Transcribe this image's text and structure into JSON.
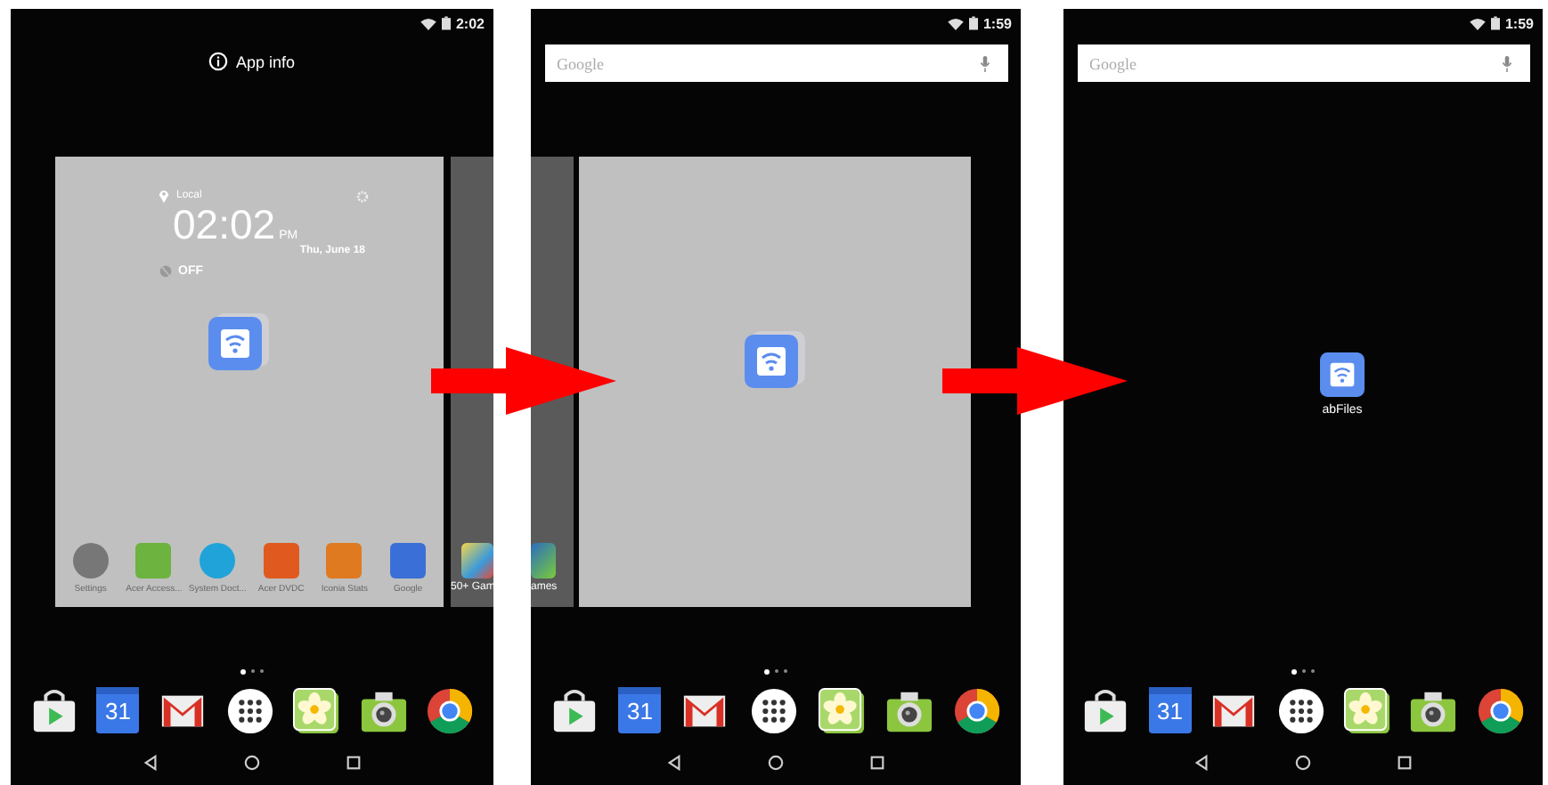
{
  "screens": [
    {
      "kind": "overview",
      "status_time": "2:02",
      "header": {
        "kind": "app_info",
        "label": "App info"
      },
      "main_card": {
        "widget": {
          "location": "Local",
          "time": "02:02",
          "meridiem": "PM",
          "date": "Thu, June 18",
          "alarm": "OFF"
        },
        "apps": [
          {
            "label": "Settings"
          },
          {
            "label": "Acer Access..."
          },
          {
            "label": "System Doct..."
          },
          {
            "label": "Acer DVDC"
          },
          {
            "label": "Iconia Stats"
          },
          {
            "label": "Google"
          }
        ],
        "dragged_app": true
      },
      "right_peek_card": {
        "app_label": "50+ Gam"
      },
      "page_dots": [
        {
          "selected": true
        },
        {
          "selected": false
        },
        {
          "selected": false
        }
      ],
      "calendar_day": "31"
    },
    {
      "kind": "overview",
      "status_time": "1:59",
      "header": {
        "kind": "search",
        "placeholder": "Google"
      },
      "main_card": {
        "dragged_app": true
      },
      "left_peek_card": {
        "app_label": "ames"
      },
      "page_dots": [
        {
          "selected": true
        },
        {
          "selected": false
        },
        {
          "selected": false
        }
      ],
      "calendar_day": "31"
    },
    {
      "kind": "home",
      "status_time": "1:59",
      "header": {
        "kind": "search",
        "placeholder": "Google"
      },
      "placed_app": {
        "label": "abFiles"
      },
      "page_dots": [
        {
          "selected": true
        },
        {
          "selected": false
        },
        {
          "selected": false
        }
      ],
      "calendar_day": "31"
    }
  ]
}
